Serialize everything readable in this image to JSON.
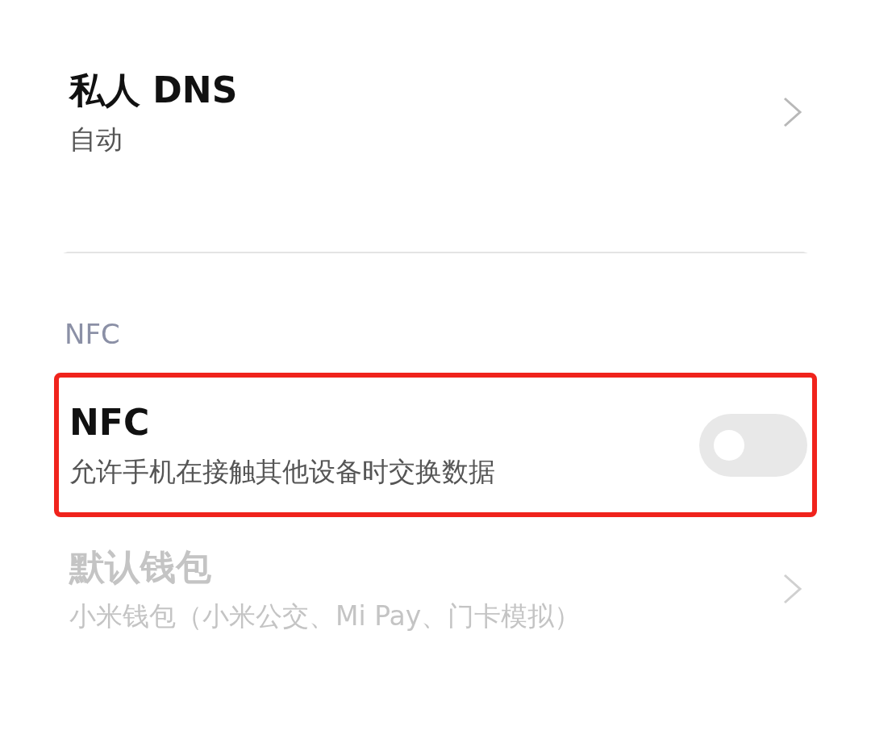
{
  "items": [
    {
      "kind": "link",
      "title": "私人 DNS",
      "subtitle": "自动",
      "disabled": false,
      "highlighted": false
    },
    {
      "kind": "section",
      "title": "NFC"
    },
    {
      "kind": "toggle",
      "title": "NFC",
      "subtitle": "允许手机在接触其他设备时交换数据",
      "on": false,
      "disabled": false,
      "highlighted": true
    },
    {
      "kind": "link",
      "title": "默认钱包",
      "subtitle": "小米钱包（小米公交、Mi Pay、门卡模拟）",
      "disabled": true,
      "highlighted": false
    }
  ]
}
